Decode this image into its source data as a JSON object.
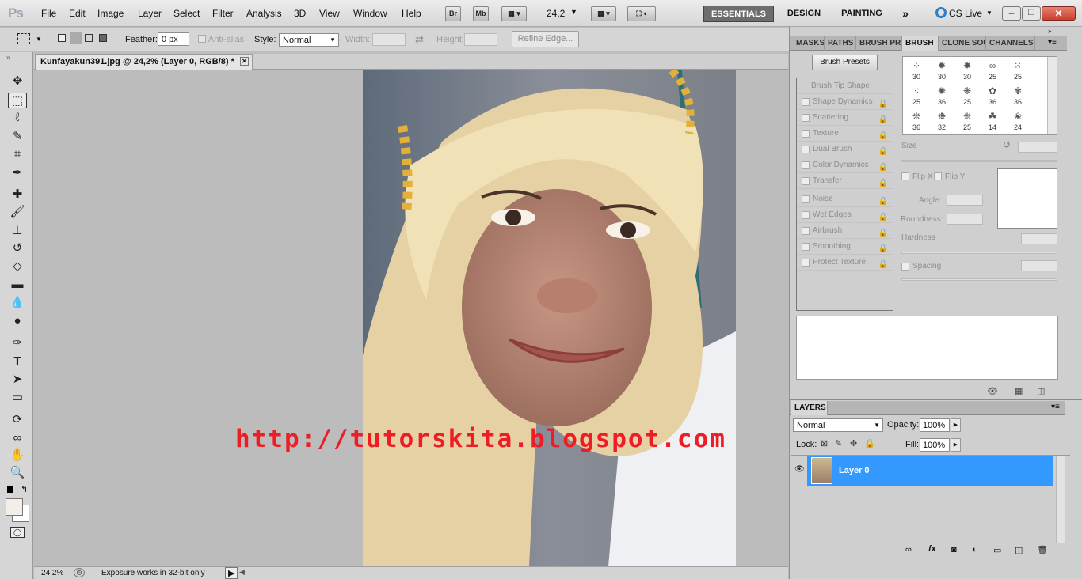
{
  "menubar": {
    "logo": "Ps",
    "items": [
      "File",
      "Edit",
      "Image",
      "Layer",
      "Select",
      "Filter",
      "Analysis",
      "3D",
      "View",
      "Window",
      "Help"
    ],
    "bridge_label": "Br",
    "minibridge_label": "Mb",
    "zoom_value": "24,2",
    "workspaces": {
      "essentials": "ESSENTIALS",
      "design": "DESIGN",
      "painting": "PAINTING"
    },
    "cslive": "CS Live"
  },
  "options": {
    "feather_label": "Feather:",
    "feather_value": "0 px",
    "antialias_label": "Anti-alias",
    "style_label": "Style:",
    "style_value": "Normal",
    "width_label": "Width:",
    "height_label": "Height:",
    "refine_label": "Refine Edge..."
  },
  "document": {
    "tab_title": "Kunfayakun391.jpg @ 24,2% (Layer 0, RGB/8) *",
    "watermark": "http://tutorskita.blogspot.com"
  },
  "status": {
    "zoom": "24,2%",
    "info": "Exposure works in 32-bit only"
  },
  "brush_panel": {
    "tabs": [
      "MASKS",
      "PATHS",
      "BRUSH PRE",
      "BRUSH",
      "CLONE SOU",
      "CHANNELS"
    ],
    "presets_button": "Brush Presets",
    "options": [
      "Brush Tip Shape",
      "Shape Dynamics",
      "Scattering",
      "Texture",
      "Dual Brush",
      "Color Dynamics",
      "Transfer",
      "Noise",
      "Wet Edges",
      "Airbrush",
      "Smoothing",
      "Protect Texture"
    ],
    "tip_sizes": [
      "30",
      "30",
      "30",
      "25",
      "25",
      "25",
      "36",
      "25",
      "36",
      "36",
      "36",
      "32",
      "25",
      "14",
      "24"
    ],
    "size_label": "Size",
    "flipx_label": "Flip X",
    "flipy_label": "Flip Y",
    "angle_label": "Angle:",
    "roundness_label": "Roundness:",
    "hardness_label": "Hardness",
    "spacing_label": "Spacing"
  },
  "layers_panel": {
    "tab": "LAYERS",
    "blend_mode": "Normal",
    "opacity_label": "Opacity:",
    "opacity_value": "100%",
    "lock_label": "Lock:",
    "fill_label": "Fill:",
    "fill_value": "100%",
    "layer_name": "Layer 0"
  },
  "colors": {
    "accent": "#3399ff",
    "watermark": "#ee1c24",
    "panel": "#cfcfcf"
  }
}
